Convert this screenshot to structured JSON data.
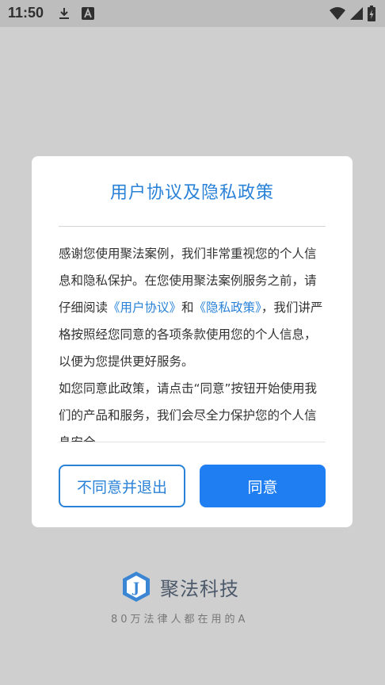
{
  "status_bar": {
    "time": "11:50",
    "left_icons": [
      "download-icon",
      "a-badge-icon"
    ],
    "right_icons": [
      "wifi-icon",
      "signal-icon",
      "battery-charging-icon"
    ]
  },
  "dialog": {
    "title": "用户协议及隐私政策",
    "body": {
      "intro": "感谢您使用聚法案例，我们非常重视您的个人信息和隐私保护。在您使用聚法案例服务之前，请仔细阅读",
      "user_agreement_link": "《用户协议》",
      "and": "和",
      "privacy_policy_link": "《隐私政策》",
      "after_links": "，我们讲严格按照经您同意的各项条款使用您的个人信息，以便为您提供更好服务。",
      "paragraph2": "如您同意此政策，请点击“同意”按钮开始使用我们的产品和服务，我们会尽全力保护您的个人信息安全。"
    },
    "decline_button": "不同意并退出",
    "agree_button": "同意"
  },
  "brand": {
    "logo_glyph": "J",
    "name": "聚法科技",
    "slogan": "80万法律人都在用的A"
  },
  "colors": {
    "accent": "#2a82d8",
    "button_primary": "#1f7ff2",
    "overlay": "#cfcfcf"
  }
}
